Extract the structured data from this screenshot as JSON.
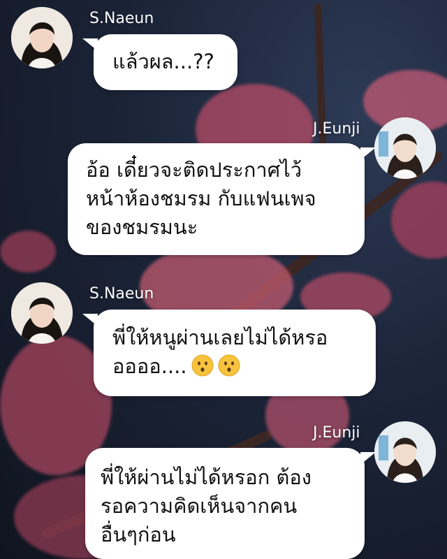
{
  "messages": [
    {
      "sender": "S.Naeun",
      "side": "left",
      "lines": [
        "แล้วผล...??"
      ]
    },
    {
      "sender": "J.Eunji",
      "side": "right",
      "lines": [
        "อ้อ เดี๋ยวจะติดประกาศไว้",
        "หน้าห้องชมรม กับแฟนเพจ",
        "ของชมรมนะ"
      ]
    },
    {
      "sender": "S.Naeun",
      "side": "left",
      "lines": [
        "พี่ให้หนูผ่านเลยไม่ได้หรอ",
        "ออออ...."
      ],
      "emojis": [
        "kissing-face-emoji",
        "kissing-face-emoji"
      ]
    },
    {
      "sender": "J.Eunji",
      "side": "right",
      "lines": [
        "พี่ให้ผ่านไม่ได้หรอก ต้อง",
        "รอความคิดเห็นจากคน",
        "อื่นๆก่อน"
      ]
    }
  ],
  "colors": {
    "bubble": "#ffffff",
    "name_text": "#ffffff",
    "message_text": "#111111",
    "background": "#1b2438",
    "blossom": "#c9546e"
  }
}
